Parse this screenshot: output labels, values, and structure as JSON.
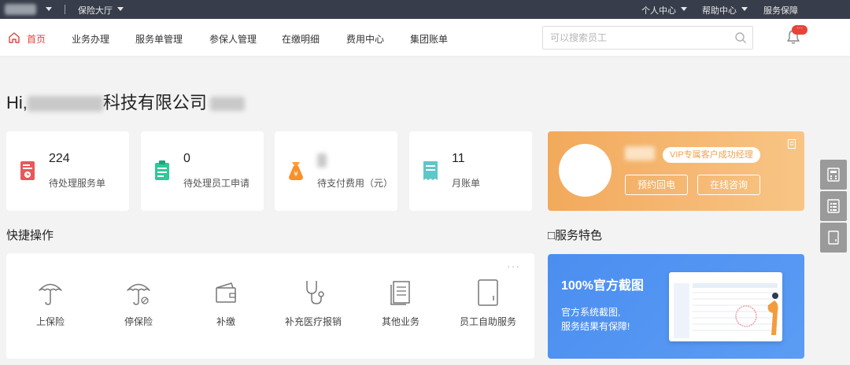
{
  "topbar": {
    "hall_label": "保险大厅",
    "personal_center": "个人中心",
    "help_center": "帮助中心",
    "service_guarantee": "服务保障"
  },
  "nav": {
    "items": [
      {
        "label": "首页"
      },
      {
        "label": "业务办理"
      },
      {
        "label": "服务单管理"
      },
      {
        "label": "参保人管理"
      },
      {
        "label": "在缴明细"
      },
      {
        "label": "费用中心"
      },
      {
        "label": "集团账单"
      }
    ],
    "search_placeholder": "可以搜索员工",
    "notification_badge": "···"
  },
  "greeting": {
    "prefix": "Hi,",
    "company_suffix": "科技有限公司"
  },
  "stats": [
    {
      "value": "224",
      "label": "待处理服务单",
      "icon": "service-order-icon",
      "color": "#e8585a"
    },
    {
      "value": "0",
      "label": "待处理员工申请",
      "icon": "clipboard-icon",
      "color": "#2fc89a"
    },
    {
      "value": "",
      "label": "待支付费用（元）",
      "icon": "money-bag-icon",
      "color": "#f6a23a"
    },
    {
      "value": "11",
      "label": "月账单",
      "icon": "receipt-icon",
      "color": "#5fc7c9"
    }
  ],
  "vip": {
    "tag": "VIP专属客户成功经理",
    "call_back": "预约回电",
    "online_consult": "在线咨询"
  },
  "quick_ops": {
    "title": "快捷操作",
    "more": "···",
    "items": [
      {
        "label": "上保险",
        "icon": "umbrella-icon"
      },
      {
        "label": "停保险",
        "icon": "umbrella-stop-icon"
      },
      {
        "label": "补缴",
        "icon": "wallet-icon"
      },
      {
        "label": "补充医疗报销",
        "icon": "stethoscope-icon"
      },
      {
        "label": "其他业务",
        "icon": "document-icon"
      },
      {
        "label": "员工自助服务",
        "icon": "tablet-icon"
      }
    ]
  },
  "service_features": {
    "title": "□服务特色",
    "banner_title": "100%官方截图",
    "banner_line1": "官方系统截图,",
    "banner_line2": "服务结果有保障!"
  },
  "colors": {
    "accent": "#e8433b",
    "topbar": "#373d4a",
    "vip_orange": "#f5b46c",
    "banner_blue": "#4f90f2"
  }
}
